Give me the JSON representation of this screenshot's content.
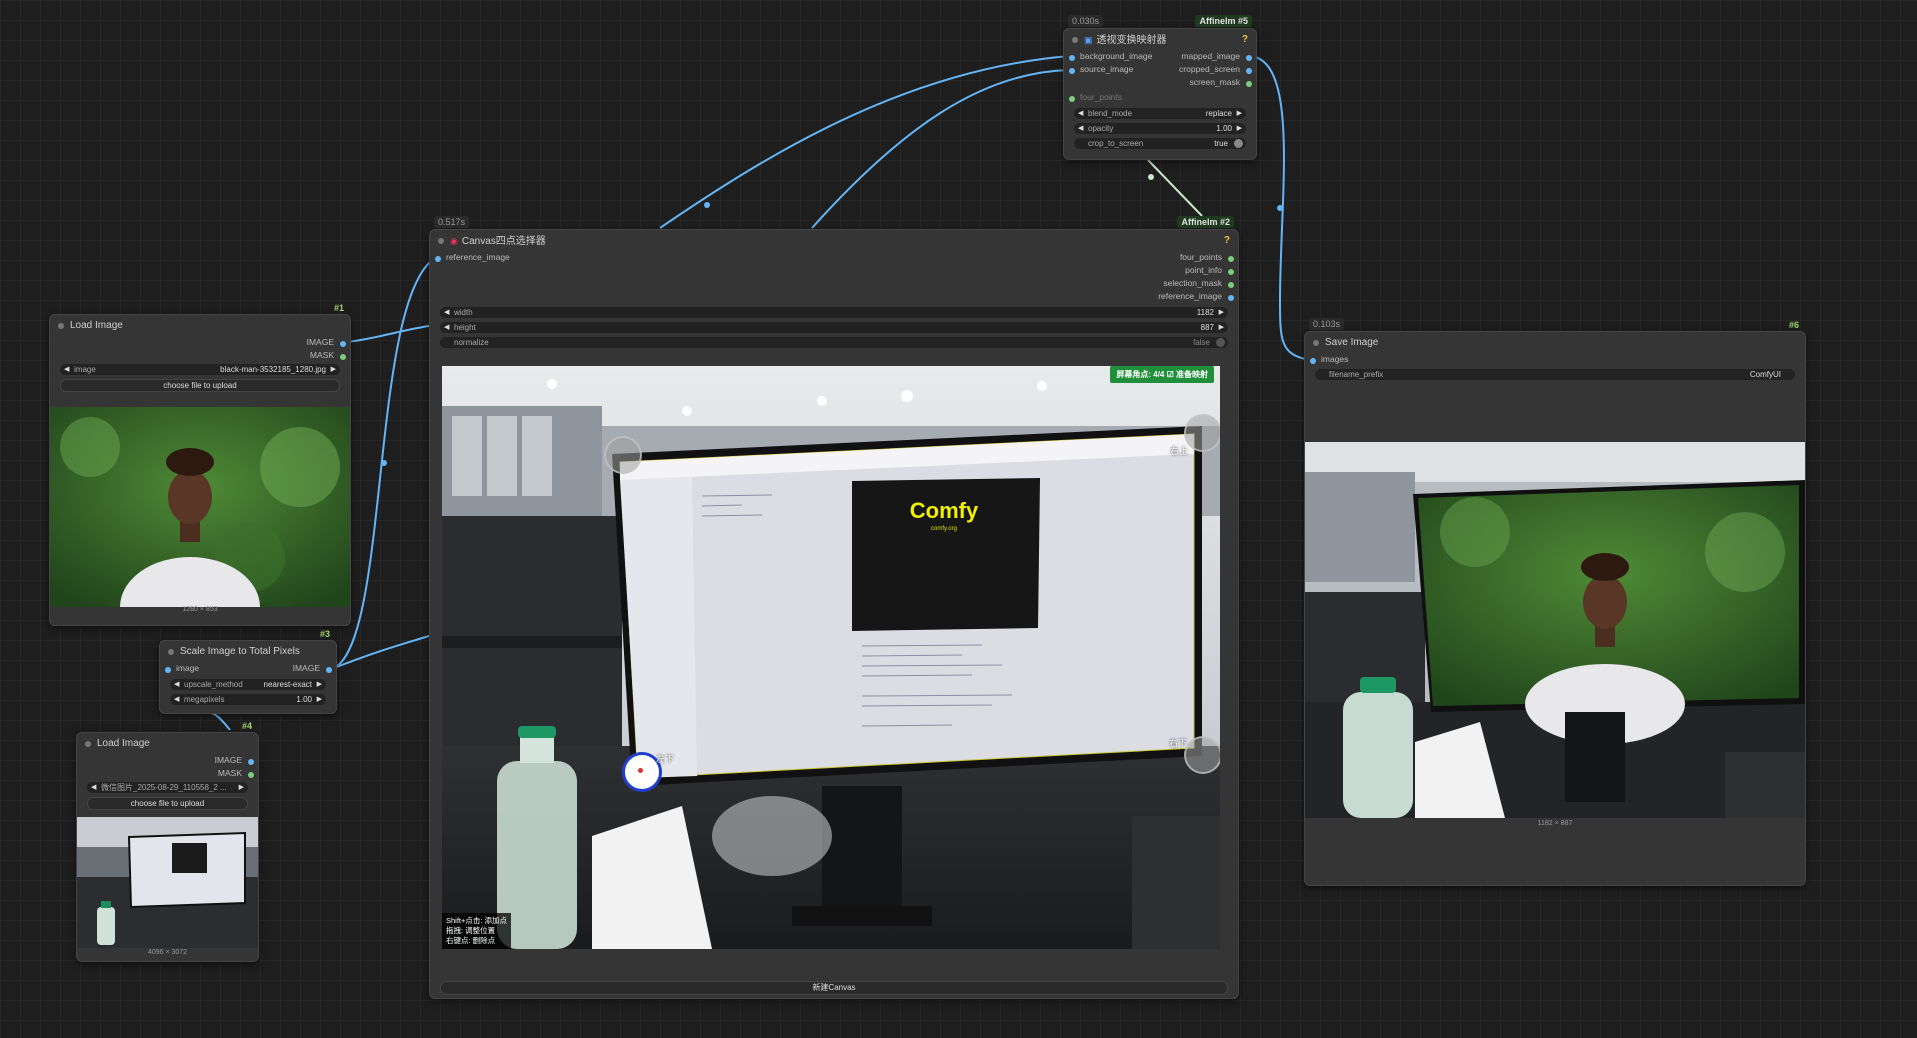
{
  "nodes": {
    "load1": {
      "title": "Load Image",
      "id": "#1",
      "outputs": [
        "IMAGE",
        "MASK"
      ],
      "image_label": "image",
      "image_value": "black-man-3532185_1280.jpg",
      "upload_label": "choose file to upload",
      "dims": "1280 × 853"
    },
    "scale3": {
      "title": "Scale Image to Total Pixels",
      "id": "#3",
      "input": "image",
      "output": "IMAGE",
      "upscale_label": "upscale_method",
      "upscale_value": "nearest-exact",
      "mp_label": "megapixels",
      "mp_value": "1.00"
    },
    "load4": {
      "title": "Load Image",
      "id": "#4",
      "outputs": [
        "IMAGE",
        "MASK"
      ],
      "image_value": "微信图片_2025-08-29_110558_2 ...",
      "upload_label": "choose file to upload",
      "dims": "4096 × 3072"
    },
    "canvas2": {
      "title": "Canvas四点选择器",
      "id": "#2",
      "time": "0.517s",
      "badge": "AffineIm",
      "input": "reference_image",
      "outputs": [
        "four_points",
        "point_info",
        "selection_mask",
        "reference_image"
      ],
      "width_label": "width",
      "width_value": "1182",
      "height_label": "height",
      "height_value": "887",
      "normalize_label": "normalize",
      "normalize_value": "false",
      "status": "屏幕角点: 4/4 ☑ 准备映射",
      "corner_tr": "右上",
      "corner_br": "右下",
      "corner_bl": "左下",
      "hint1": "Shift+点击: 添加点",
      "hint2": "拖拽: 调整位置",
      "hint3": "右键点: 删除点",
      "new_canvas": "新建Canvas",
      "screen_logo": "Comfy",
      "screen_url": "comfy.org"
    },
    "affine5": {
      "title": "透视变换映射器",
      "id": "#5",
      "time": "0.030s",
      "badge": "AffineIm",
      "inputs": [
        "background_image",
        "source_image"
      ],
      "outputs": [
        "mapped_image",
        "cropped_screen",
        "screen_mask"
      ],
      "four_points": "four_points",
      "blend_label": "blend_mode",
      "blend_value": "replace",
      "opacity_label": "opacity",
      "opacity_value": "1.00",
      "crop_label": "crop_to_screen",
      "crop_value": "true"
    },
    "save6": {
      "title": "Save Image",
      "id": "#6",
      "time": "0.103s",
      "input": "images",
      "prefix_label": "filename_prefix",
      "prefix_value": "ComfyUI",
      "dims": "1182 × 887"
    }
  },
  "colors": {
    "canvas_bg": "#1e1e1e",
    "node_bg": "#353535",
    "link": "#64b5f6",
    "link_points": "#c9e6c9",
    "status_green": "#1f8f3a",
    "node_id": "#9fd46b"
  }
}
